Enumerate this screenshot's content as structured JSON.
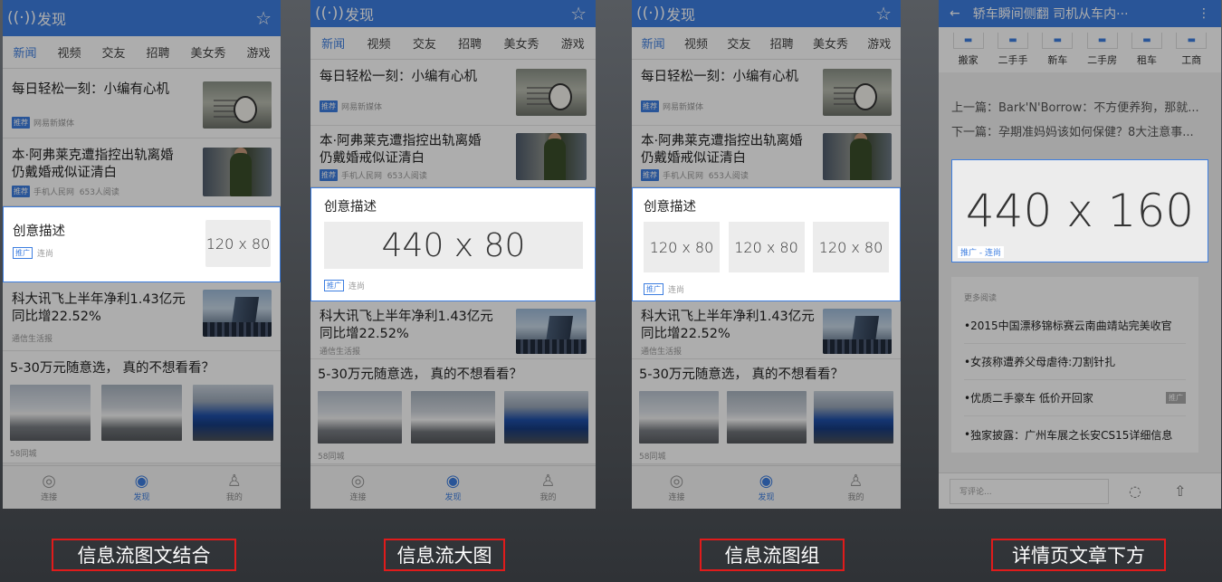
{
  "app": {
    "title": "发现"
  },
  "tabs": [
    "新闻",
    "视频",
    "交友",
    "招聘",
    "美女秀",
    "游戏"
  ],
  "news": {
    "item1": {
      "title": "每日轻松一刻：小编有心机",
      "tag": "推荐",
      "source": "网易新媒体"
    },
    "item2": {
      "title_l1": "本·阿弗莱克遭指控出轨离婚",
      "title_l2": "仍戴婚戒似证清白",
      "tag": "推荐",
      "source": "手机人民网",
      "reads": "653人阅读"
    },
    "item3": {
      "title_l1": "科大讯飞上半年净利1.43亿元",
      "title_l2": "同比增22.52%",
      "source": "通信生活报"
    },
    "item4": {
      "title": "5-30万元随意选， 真的不想看看？",
      "source": "58同城"
    }
  },
  "ads": {
    "title": "创意描述",
    "tag": "推广",
    "advertiser": "连尚",
    "small": "120 x 80",
    "large": "440 x 80",
    "detail_size": "440 x 160",
    "detail_tag": "推广 - 连尚"
  },
  "nav": [
    "连接",
    "发现",
    "我的"
  ],
  "detail": {
    "title": "轿车瞬间侧翻 司机从车内···",
    "categories": [
      "搬家",
      "二手手",
      "新车",
      "二手房",
      "租车",
      "工商"
    ],
    "prev": "上一篇：Bark'N'Borrow：不方便养狗，那就...",
    "next": "下一篇：孕期准妈妈该如何保健？8大注意事...",
    "more_title": "更多阅读",
    "more": [
      "2015中国漂移锦标赛云南曲靖站完美收官",
      "女孩称遭养父母虐待:刀割针扎",
      "优质二手豪车 低价开回家",
      "独家披露：广州车展之长安CS15详细信息"
    ],
    "more_badge": "推广",
    "comment_placeholder": "写评论..."
  },
  "captions": [
    "信息流图文结合",
    "信息流大图",
    "信息流图组",
    "详情页文章下方"
  ]
}
